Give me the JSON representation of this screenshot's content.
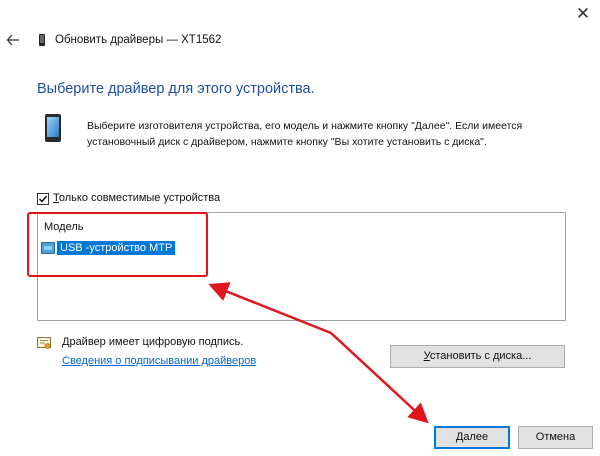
{
  "window": {
    "title": "Обновить драйверы — XT1562",
    "close_glyph": "✕"
  },
  "heading": "Выберите драйвер для этого устройства.",
  "description": "Выберите изготовителя устройства, его модель и нажмите кнопку \"Далее\". Если имеется установочный диск с  драйвером, нажмите кнопку \"Вы хотите установить с диска\".",
  "compatible_checkbox": {
    "label_underlined": "Т",
    "label_rest": "олько совместимые устройства",
    "checked": true
  },
  "model_list": {
    "header": "Модель",
    "items": [
      {
        "label": "USB -устройство MTP",
        "selected": true
      }
    ]
  },
  "signature": {
    "text": "Драйвер имеет цифровую подпись.",
    "link": "Сведения о подписывании драйверов"
  },
  "buttons": {
    "install_from_disk_underlined": "У",
    "install_from_disk_rest": "становить с диска...",
    "next": "Далее",
    "cancel": "Отмена"
  },
  "icons": {
    "back": "back-arrow-icon",
    "device": "phone-device-icon",
    "close": "close-icon",
    "signature": "certificate-icon"
  },
  "colors": {
    "heading": "#1f4e9c",
    "selection": "#0078d7",
    "annotation": "#e0151d",
    "link": "#0066cc"
  }
}
